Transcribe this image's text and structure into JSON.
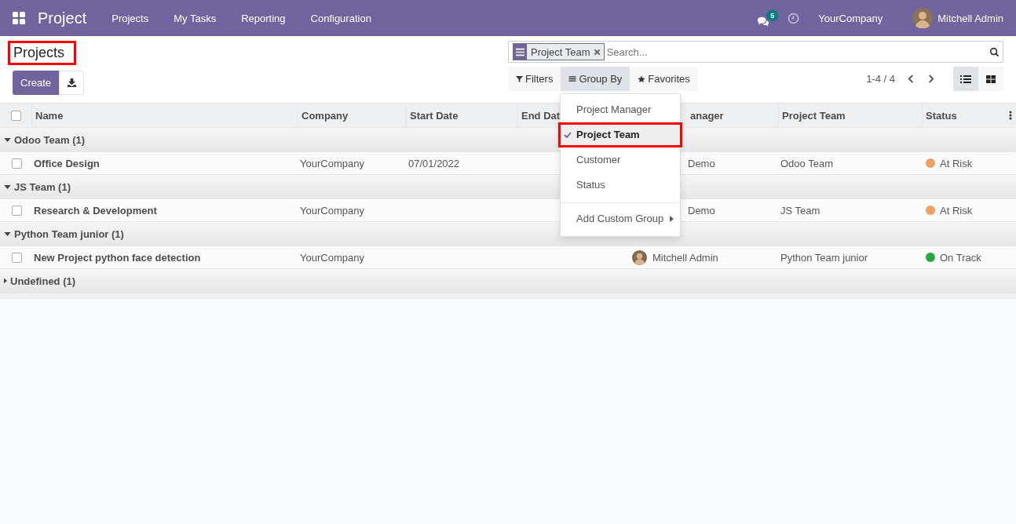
{
  "navbar": {
    "app_name": "Project",
    "menu": [
      "Projects",
      "My Tasks",
      "Reporting",
      "Configuration"
    ],
    "messages_badge": "5",
    "company": "YourCompany",
    "user": "Mitchell Admin"
  },
  "control_panel": {
    "title": "Projects",
    "title_highlighted": true,
    "create_button": "Create",
    "search": {
      "facet": "Project Team",
      "placeholder": "Search..."
    },
    "search_buttons": [
      {
        "kind": "filter",
        "label": "Filters",
        "selected": false
      },
      {
        "kind": "group",
        "label": "Group By",
        "selected": true
      },
      {
        "kind": "favorite",
        "label": "Favorites",
        "selected": false
      }
    ],
    "pager": "1-4 / 4",
    "views": [
      {
        "kind": "list",
        "selected": true
      },
      {
        "kind": "kanban",
        "selected": false
      }
    ]
  },
  "group_by_menu": {
    "items": [
      {
        "label": "Project Manager",
        "selected": false,
        "highlighted": false
      },
      {
        "label": "Project Team",
        "selected": true,
        "highlighted": true
      },
      {
        "label": "Customer",
        "selected": false,
        "highlighted": false
      },
      {
        "label": "Status",
        "selected": false,
        "highlighted": false
      }
    ],
    "custom_group": "Add Custom Group"
  },
  "table": {
    "all_checked": false,
    "columns": [
      "Name",
      "Company",
      "Start Date",
      "End Dat",
      "anager",
      "Project Team",
      "Status"
    ],
    "groups": [
      {
        "label": "Odoo Team (1)",
        "expanded": true,
        "rows": [
          {
            "checked": false,
            "name": "Office Design",
            "company": "YourCompany",
            "start_date": "07/01/2022",
            "manager": "Demo",
            "project_team": "Odoo Team",
            "status": "At Risk",
            "color": "#f0a05e"
          }
        ]
      },
      {
        "label": "JS Team (1)",
        "expanded": true,
        "rows": [
          {
            "checked": false,
            "name": "Research & Development",
            "company": "YourCompany",
            "manager": "Demo",
            "project_team": "JS Team",
            "status": "At Risk",
            "color": "#f0a05e"
          }
        ]
      },
      {
        "label": "Python Team junior (1)",
        "expanded": true,
        "rows": [
          {
            "checked": false,
            "name": "New Project python face detection",
            "company": "YourCompany",
            "manager": "Mitchell Admin",
            "manager_avatar": true,
            "project_team": "Python Team junior",
            "status": "On Track",
            "color": "#28a745"
          }
        ]
      },
      {
        "label": "Undefined (1)",
        "expanded": false
      }
    ]
  }
}
